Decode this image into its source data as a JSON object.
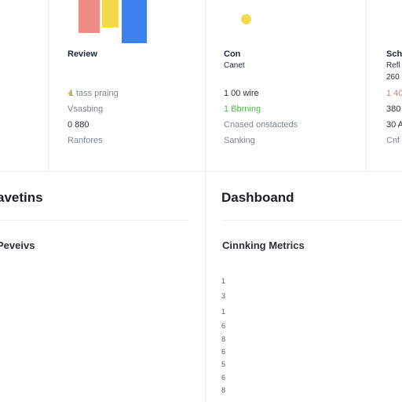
{
  "colors": {
    "red": "#f08c86",
    "yellow": "#f5d94a",
    "blue": "#3b82f0",
    "warn_red": "#e07a6e",
    "good_green": "#53b653"
  },
  "cards": [
    {
      "title": "Review",
      "lines": [
        "1 tass praing",
        "Vsasbing",
        "0 880",
        "Ranfores"
      ]
    },
    {
      "title": "Con",
      "subtitle": "Canet",
      "lines": [
        "1 00 wire",
        "1 Bbrning",
        "Cnased onstacteds",
        "Sanking"
      ]
    },
    {
      "title": "Sch",
      "lines": [
        "Refl",
        "260",
        "1 40",
        "380",
        "30 A",
        "Cnf"
      ]
    }
  ],
  "left_panel": {
    "title": "avetins",
    "subtitle": "Peveivs"
  },
  "dashboard": {
    "title": "Dashboand",
    "subtitle": "Cinnking Metrics",
    "list": [
      "1",
      "3",
      "1",
      "6",
      "8",
      "6",
      "5",
      "6",
      "8"
    ]
  }
}
